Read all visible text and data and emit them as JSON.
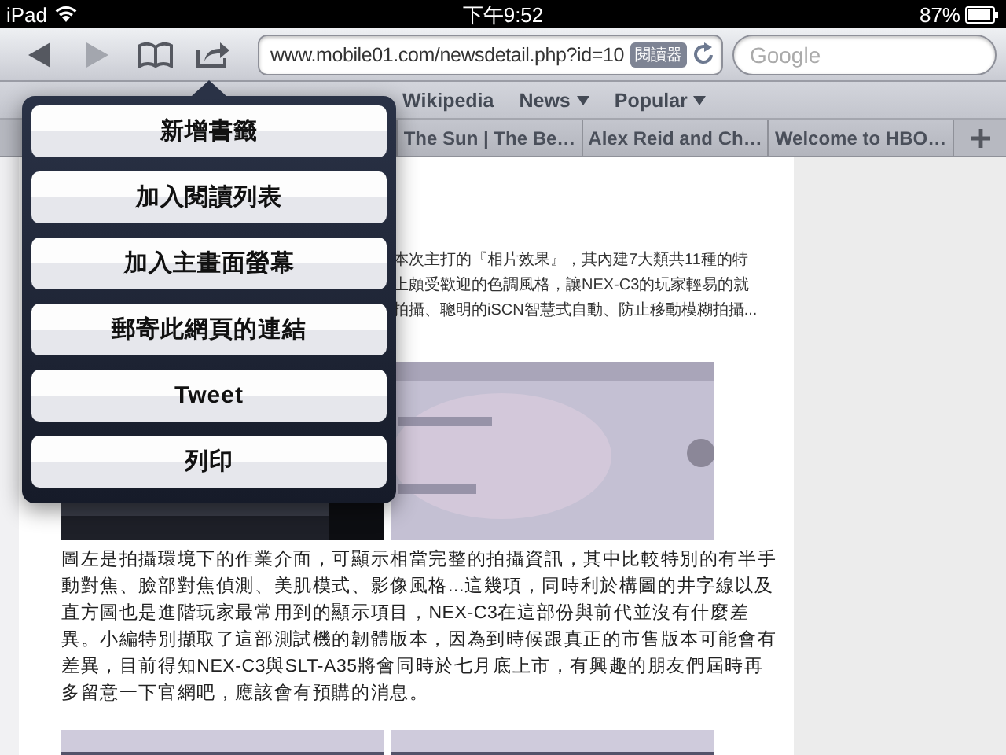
{
  "status_bar": {
    "device": "iPad",
    "time": "下午9:52",
    "battery": "87%"
  },
  "toolbar": {
    "back": {
      "disabled": false
    },
    "forward": {
      "disabled": true
    },
    "url": "www.mobile01.com/newsdetail.php?id=10",
    "reader": "閱讀器",
    "search": {
      "placeholder": "Google"
    }
  },
  "bookmarks": [
    {
      "label": "Wikipedia",
      "menu": false
    },
    {
      "label": "News",
      "menu": true
    },
    {
      "label": "Popular",
      "menu": true
    }
  ],
  "tabs": [
    {
      "title": "The Sun | The Be…"
    },
    {
      "title": "Alex Reid and Ch…"
    },
    {
      "title": "Welcome to HBO…"
    }
  ],
  "article": {
    "intro_lines": [
      "本次主打的『相片效果』，其內建7大類共11種的特",
      "上頗受歡迎的色調風格，讓NEX-C3的玩家輕易的就",
      "拍攝、聰明的iSCN智慧式自動、防止移動模糊拍攝..."
    ],
    "paragraph": "圖左是拍攝環境下的作業介面，可顯示相當完整的拍攝資訊，其中比較特別的有半手動對焦、臉部對焦偵測、美肌模式、影像風格...這幾項，同時利於構圖的井字線以及直方圖也是進階玩家最常用到的顯示項目，NEX-C3在這部份與前代並沒有什麼差異。小編特別擷取了這部測試機的韌體版本，因為到時候跟真正的市售版本可能會有差異，目前得知NEX-C3與SLT-A35將會同時於七月底上市，有興趣的朋友們屆時再多留意一下官網吧，應該會有預購的消息。"
  },
  "share_menu": {
    "items": [
      {
        "label": "新增書籤"
      },
      {
        "label": "加入閱讀列表"
      },
      {
        "label": "加入主畫面螢幕"
      },
      {
        "label": "郵寄此網頁的連結"
      },
      {
        "label": "Tweet"
      },
      {
        "label": "列印"
      }
    ]
  }
}
